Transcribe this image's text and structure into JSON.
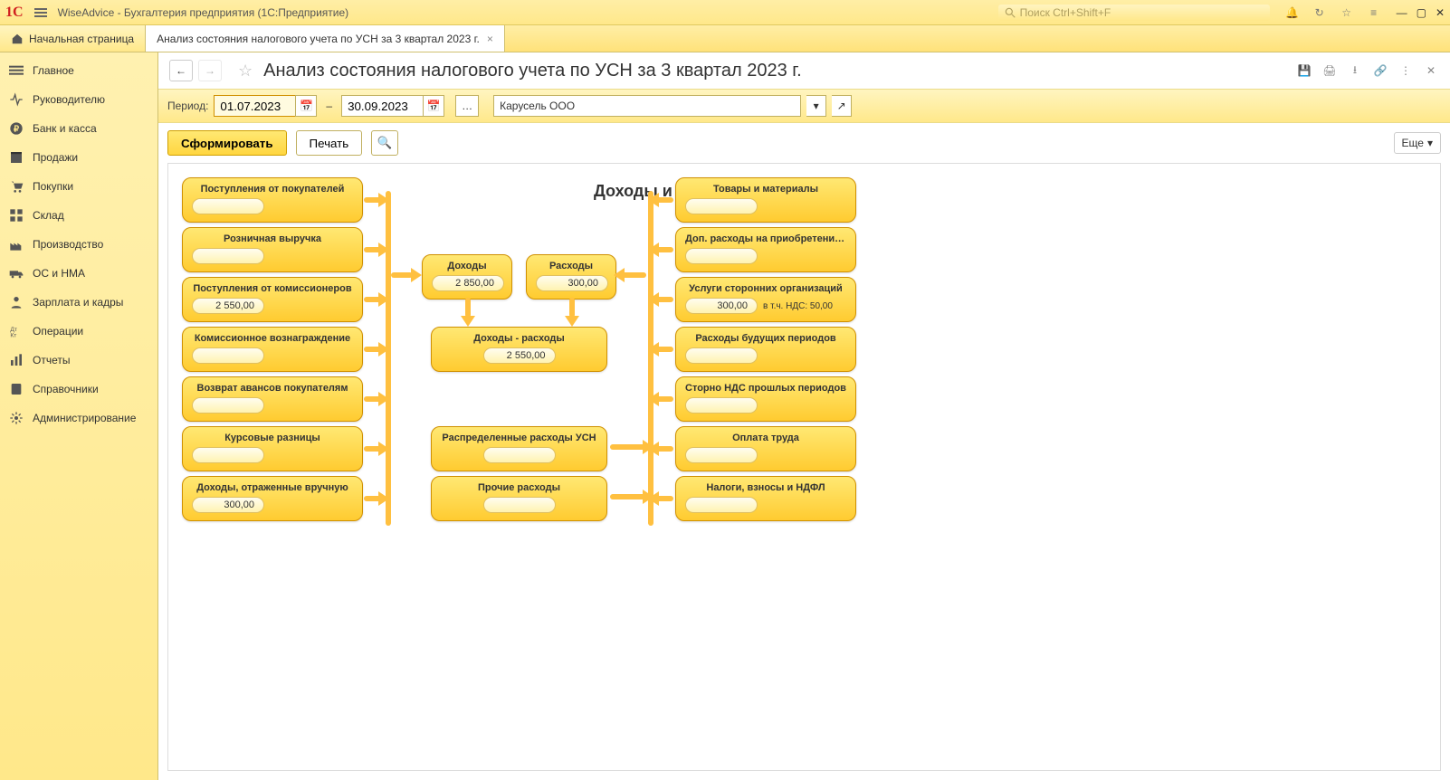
{
  "app_title": "WiseAdvice - Бухгалтерия предприятия  (1С:Предприятие)",
  "search_placeholder": "Поиск Ctrl+Shift+F",
  "tabs": {
    "home": "Начальная страница",
    "current": "Анализ состояния налогового учета по УСН за 3 квартал 2023 г."
  },
  "sidebar": [
    {
      "id": "main",
      "label": "Главное"
    },
    {
      "id": "manager",
      "label": "Руководителю"
    },
    {
      "id": "bank",
      "label": "Банк и касса"
    },
    {
      "id": "sales",
      "label": "Продажи"
    },
    {
      "id": "purchases",
      "label": "Покупки"
    },
    {
      "id": "warehouse",
      "label": "Склад"
    },
    {
      "id": "production",
      "label": "Производство"
    },
    {
      "id": "os",
      "label": "ОС и НМА"
    },
    {
      "id": "salary",
      "label": "Зарплата и кадры"
    },
    {
      "id": "operations",
      "label": "Операции"
    },
    {
      "id": "reports",
      "label": "Отчеты"
    },
    {
      "id": "refs",
      "label": "Справочники"
    },
    {
      "id": "admin",
      "label": "Администрирование"
    }
  ],
  "page_title": "Анализ состояния налогового учета по УСН за 3 квартал 2023 г.",
  "period": {
    "label": "Период:",
    "from": "01.07.2023",
    "to": "30.09.2023",
    "dash": "–"
  },
  "org": "Карусель ООО",
  "buttons": {
    "form": "Сформировать",
    "print": "Печать",
    "more": "Еще"
  },
  "report": {
    "heading": "Доходы и расходы УСН",
    "left": [
      {
        "title": "Поступления от покупателей",
        "value": ""
      },
      {
        "title": "Розничная выручка",
        "value": ""
      },
      {
        "title": "Поступления от комиссионеров",
        "value": "2 550,00"
      },
      {
        "title": "Комиссионное вознаграждение",
        "value": ""
      },
      {
        "title": "Возврат авансов покупателям",
        "value": ""
      },
      {
        "title": "Курсовые разницы",
        "value": ""
      },
      {
        "title": "Доходы, отраженные вручную",
        "value": "300,00"
      }
    ],
    "center": {
      "income": {
        "title": "Доходы",
        "value": "2 850,00"
      },
      "expense": {
        "title": "Расходы",
        "value": "300,00"
      },
      "diff": {
        "title": "Доходы - расходы",
        "value": "2 550,00"
      },
      "distributed": {
        "title": "Распределенные расходы УСН",
        "value": ""
      },
      "other": {
        "title": "Прочие расходы",
        "value": ""
      }
    },
    "right": [
      {
        "title": "Товары и материалы",
        "value": ""
      },
      {
        "title": "Доп. расходы на приобретение ТМЦ",
        "value": ""
      },
      {
        "title": "Услуги сторонних организаций",
        "value": "300,00",
        "note": "в т.ч. НДС: 50,00"
      },
      {
        "title": "Расходы будущих периодов",
        "value": ""
      },
      {
        "title": "Сторно НДС прошлых периодов",
        "value": ""
      },
      {
        "title": "Оплата труда",
        "value": ""
      },
      {
        "title": "Налоги, взносы и НДФЛ",
        "value": ""
      }
    ]
  }
}
